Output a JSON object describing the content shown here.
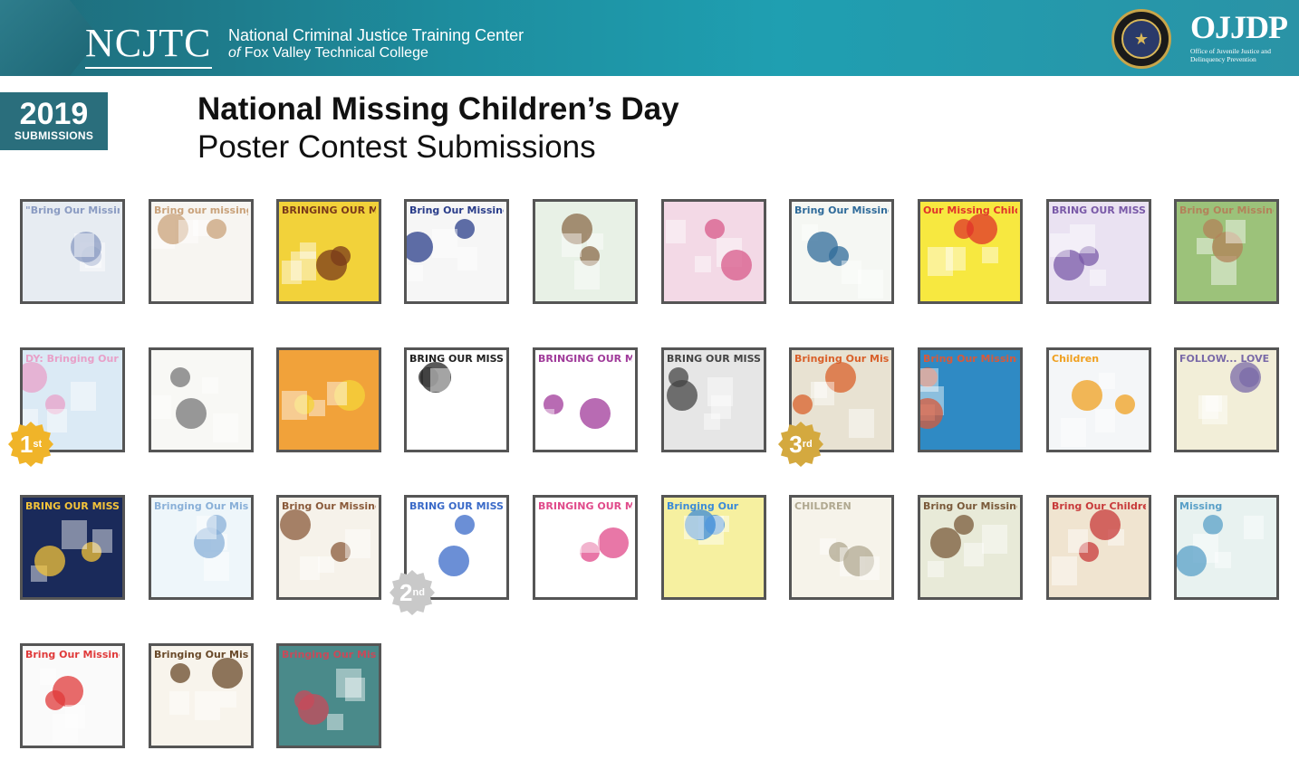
{
  "header": {
    "logo_text": "NCJTC",
    "org_line1": "National Criminal Justice Training Center",
    "org_line2_prefix": "of",
    "org_line2_rest": " Fox Valley Technical College",
    "partner_logo": "OJJDP",
    "partner_name": "Office of Juvenile Justice and Delinquency Prevention",
    "seal_icon": "doj-seal-icon"
  },
  "badge": {
    "year": "2019",
    "label": "SUBMISSIONS"
  },
  "title": {
    "line1": "National Missing Children’s Day",
    "line2": "Poster Contest Submissions"
  },
  "medals": {
    "first": {
      "num": "1",
      "suffix": "st"
    },
    "second": {
      "num": "2",
      "suffix": "nd"
    },
    "third": {
      "num": "3",
      "suffix": "rd"
    }
  },
  "posters": [
    {
      "caption": "\"Bring Our Missing Children Home\"",
      "bg": "#e7ecf2",
      "accent": "#8a9bc2"
    },
    {
      "caption": "Bring our missing children home",
      "bg": "#f7f5f1",
      "accent": "#c9a27a"
    },
    {
      "caption": "BRINGING OUR MISSING CHILDREN HOME",
      "bg": "#f2d23a",
      "accent": "#7a3a1a"
    },
    {
      "caption": "Bring Our Missing Children Home",
      "bg": "#f6f6f6",
      "accent": "#2a3d8a"
    },
    {
      "caption": "",
      "bg": "#e8f1e6",
      "accent": "#8b6b4a"
    },
    {
      "caption": "",
      "bg": "#f3d9e6",
      "accent": "#d85a8a"
    },
    {
      "caption": "Bring Our Missing Children",
      "bg": "#f5f7f3",
      "accent": "#2f6b9a"
    },
    {
      "caption": "Our Missing Children Home",
      "bg": "#f7e840",
      "accent": "#e0332a"
    },
    {
      "caption": "BRING OUR MISSING CHILDREN",
      "bg": "#eae2f2",
      "accent": "#7a5aa8"
    },
    {
      "caption": "Bring Our Missing Children HOME",
      "bg": "#9cc27a",
      "accent": "#b3825a"
    },
    {
      "caption": "DY: Bringing Our Missing Children Home",
      "bg": "#dbeaf5",
      "accent": "#e8a0c8"
    },
    {
      "caption": "",
      "bg": "#f8f8f5",
      "accent": "#777777"
    },
    {
      "caption": "",
      "bg": "#f1a23a",
      "accent": "#f4d43a"
    },
    {
      "caption": "BRING OUR MISSING CHILDREN HOME",
      "bg": "#ffffff",
      "accent": "#222222"
    },
    {
      "caption": "BRINGING OUR MISSING",
      "bg": "#ffffff",
      "accent": "#a03a9a"
    },
    {
      "caption": "BRING OUR MISSING CHILDREN HOME",
      "bg": "#e6e6e6",
      "accent": "#444444"
    },
    {
      "caption": "Bringing Our Missing Children Home",
      "bg": "#e8e2d2",
      "accent": "#d9602a"
    },
    {
      "caption": "Bring Our Missing Children Home",
      "bg": "#2f8ac4",
      "accent": "#d85a3a"
    },
    {
      "caption": "Children",
      "bg": "#f4f6f8",
      "accent": "#f0a020"
    },
    {
      "caption": "FOLLOW... LOVE BRING OUR MISSING CHILDREN HOME",
      "bg": "#f2eed8",
      "accent": "#7a6aa8"
    },
    {
      "caption": "BRING OUR MISSING CHILDREN HOME",
      "bg": "#1a2a5a",
      "accent": "#f4c43a"
    },
    {
      "caption": "Bringing Our Missing Children",
      "bg": "#eef6fa",
      "accent": "#8ab0d8"
    },
    {
      "caption": "Bring Our Missing Children Home!",
      "bg": "#f6f2ea",
      "accent": "#8a5a3a"
    },
    {
      "caption": "BRING OUR MISSING CHILDREN",
      "bg": "#ffffff",
      "accent": "#3a6ac8"
    },
    {
      "caption": "BRINGING OUR MISSING",
      "bg": "#ffffff",
      "accent": "#e04a8a"
    },
    {
      "caption": "Bringing Our",
      "bg": "#f6f0a0",
      "accent": "#3a8ad8"
    },
    {
      "caption": "CHILDREN",
      "bg": "#f6f3ea",
      "accent": "#b0a890"
    },
    {
      "caption": "Bring Our Missing Children HOME",
      "bg": "#e8ead8",
      "accent": "#7a5a3a"
    },
    {
      "caption": "Bring Our Children Home",
      "bg": "#f0e4d0",
      "accent": "#c83a3a"
    },
    {
      "caption": "Missing",
      "bg": "#e8f2f0",
      "accent": "#5aa0c8"
    },
    {
      "caption": "Bring Our Missing Children Home",
      "bg": "#fafafa",
      "accent": "#e03a3a"
    },
    {
      "caption": "Bringing Our Missing Children Home",
      "bg": "#f8f4ec",
      "accent": "#6a4a2a"
    },
    {
      "caption": "Bringing Our Missing Children",
      "bg": "#4a8a8a",
      "accent": "#c84a5a"
    }
  ]
}
